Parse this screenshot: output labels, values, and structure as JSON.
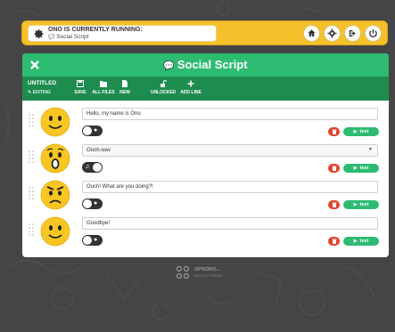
{
  "status": {
    "title": "ONO IS CURRENTLY RUNNING:",
    "script": "Social Script",
    "icons": [
      "home-icon",
      "gear-icon",
      "logout-icon",
      "power-icon"
    ]
  },
  "panel": {
    "title": "Social Script",
    "document": {
      "name": "UNTITLED",
      "state": "EDITING"
    },
    "toolbar": [
      {
        "label": "SAVE",
        "icon": "save-icon"
      },
      {
        "label": "ALL FILES",
        "icon": "folder-icon"
      },
      {
        "label": "NEW",
        "icon": "new-file-icon"
      },
      {
        "label": "UNLOCKED",
        "icon": "unlocked-icon"
      },
      {
        "label": "ADD LINE",
        "icon": "plus-icon"
      }
    ],
    "lines": [
      {
        "emotion": "happy",
        "kind": "text",
        "value": "Hello, my name is Ono",
        "toggle": "speech"
      },
      {
        "emotion": "surprised",
        "kind": "sound",
        "value": "Oooh.wav",
        "toggle": "sound"
      },
      {
        "emotion": "angry",
        "kind": "text",
        "value": "Ouch! What are you doing?!",
        "toggle": "speech"
      },
      {
        "emotion": "happy",
        "kind": "text",
        "value": "Goodbye!",
        "toggle": "speech"
      }
    ],
    "test_label": "test"
  },
  "footer": {
    "brand": "OPSORO...",
    "tagline": "BUILD A FRIEND"
  },
  "colors": {
    "accent_yellow": "#f5c12b",
    "header_green": "#2dbb72",
    "toolbar_green": "#1e8c4f",
    "delete_red": "#e0432c",
    "background": "#454545"
  }
}
